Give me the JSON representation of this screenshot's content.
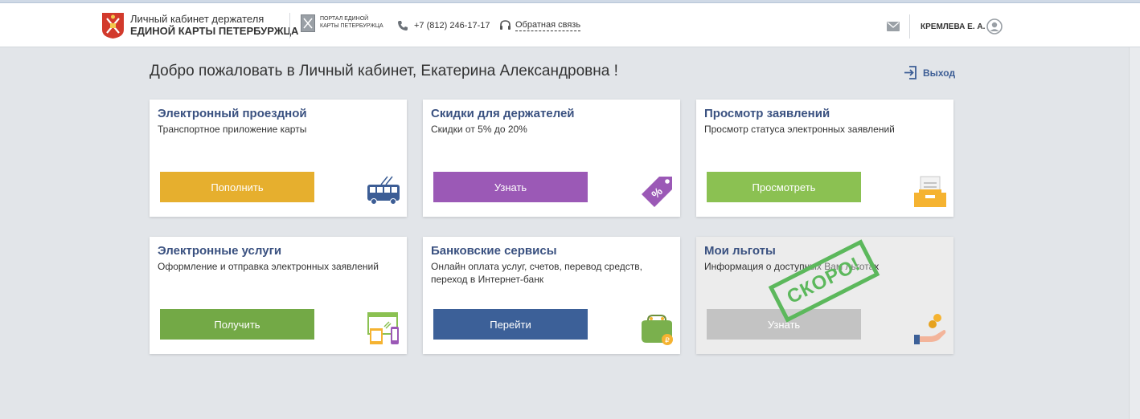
{
  "header": {
    "brand_line1": "Личный кабинет держателя",
    "brand_line2": "ЕДИНОЙ КАРТЫ ПЕТЕРБУРЖЦА",
    "portal_line1": "ПОРТАЛ ЕДИНОЙ",
    "portal_line2": "КАРТЫ ПЕТЕРБУРЖЦА",
    "phone": "+7 (812) 246-17-17",
    "feedback": "Обратная связь",
    "username": "КРЕМЛЕВА Е. А."
  },
  "main": {
    "welcome": "Добро пожаловать в Личный кабинет, Екатерина Александровна !",
    "logout": "Выход"
  },
  "cards": [
    {
      "title": "Электронный проездной",
      "desc": "Транспортное приложение карты",
      "button": "Пополнить",
      "color": "#e6af2e",
      "icon": "trolleybus-icon"
    },
    {
      "title": "Скидки для держателей",
      "desc": "Скидки от 5% до 20%",
      "button": "Узнать",
      "color": "#9b59b6",
      "icon": "discount-tag-icon"
    },
    {
      "title": "Просмотр заявлений",
      "desc": "Просмотр статуса электронных заявлений",
      "button": "Просмотреть",
      "color": "#8bc152",
      "icon": "inbox-icon"
    },
    {
      "title": "Электронные услуги",
      "desc": "Оформление и отправка электронных заявлений",
      "button": "Получить",
      "color": "#73a946",
      "icon": "devices-icon"
    },
    {
      "title": "Банковские сервисы",
      "desc": "Онлайн оплата услуг, счетов, перевод средств, переход в Интернет-банк",
      "button": "Перейти",
      "color": "#3c6098",
      "icon": "wallet-icon"
    },
    {
      "title": "Мои льготы",
      "desc": "Информация о доступных Вам льготах",
      "button": "Узнать",
      "color": "#c3c3c3",
      "icon": "coins-hand-icon"
    }
  ],
  "stamp": "СКОРО!"
}
